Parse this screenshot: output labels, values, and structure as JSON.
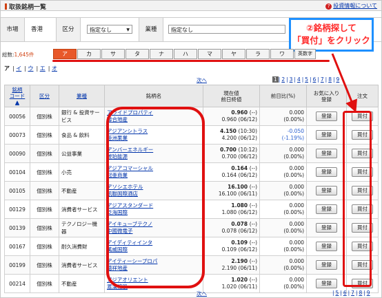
{
  "header": {
    "title": "取扱銘柄一覧",
    "help_link": "投資情報について",
    "help_icon": "help-icon"
  },
  "filter": {
    "market_label": "市場",
    "market_value": "香港",
    "kubun_label": "区分",
    "kubun_value": "指定なし",
    "industry_label": "業種",
    "industry_value": "指定なし"
  },
  "callout": {
    "line1": "②銘柄探して",
    "line2": "「買付」をクリック",
    "border_color": "#1e90ff",
    "text_color": "#ff2a2a"
  },
  "count": {
    "label": "総数:",
    "value": "1,645件"
  },
  "kana_tabs": [
    "ア",
    "カ",
    "サ",
    "タ",
    "ナ",
    "ハ",
    "マ",
    "ヤ",
    "ラ",
    "ワ",
    "英数字"
  ],
  "active_kana": "ア",
  "sub_tabs": {
    "current": "ア",
    "links": [
      "イ",
      "ウ",
      "エ",
      "オ"
    ]
  },
  "pager_top": {
    "next": "次へ",
    "current": "1",
    "pages": [
      "2",
      "3",
      "4",
      "5",
      "6",
      "7",
      "8",
      "9"
    ]
  },
  "pager_bottom": {
    "next": "次へ",
    "pages": [
      "5",
      "6",
      "7",
      "8",
      "9"
    ]
  },
  "table": {
    "headers": {
      "code": "銘柄\nコード\n▲",
      "kubun": "区分",
      "industry": "業種",
      "name": "銘柄名",
      "price": "現在値\n前日終値",
      "change": "前日比(%)",
      "fav": "お気に入り\n登録",
      "order": "注文"
    },
    "fav_label": "登録",
    "buy_label": "買付",
    "rows": [
      {
        "code": "00056",
        "kubun": "個別株",
        "industry": "銀行 & 投資サービス",
        "name1": "アライドプロパティ",
        "name2": "聯合地産",
        "price": "0.960",
        "ptime": "(--)",
        "prev": "0.960",
        "pdate": "(06/12)",
        "chg1": "0.000",
        "chg2": "(0.00%)"
      },
      {
        "code": "00073",
        "kubun": "個別株",
        "industry": "食品 & 飲料",
        "name1": "アジアンシトラス",
        "name2": "亜洲果業",
        "price": "4.150",
        "ptime": "(10:30)",
        "prev": "4.200",
        "pdate": "(06/12)",
        "chg1": "-0.050",
        "chg2": "(-1.19%)"
      },
      {
        "code": "00090",
        "kubun": "個別株",
        "industry": "公益事業",
        "name1": "アンバーエネルギー",
        "name2": "琥珀能源",
        "price": "0.700",
        "ptime": "(10:12)",
        "prev": "0.700",
        "pdate": "(06/12)",
        "chg1": "0.000",
        "chg2": "(0.00%)"
      },
      {
        "code": "00104",
        "kubun": "個別株",
        "industry": "小売",
        "name1": "アジアコマーシャル",
        "name2": "冠亜商業",
        "price": "0.164",
        "ptime": "(--)",
        "prev": "0.164",
        "pdate": "(06/12)",
        "chg1": "0.000",
        "chg2": "(0.00%)"
      },
      {
        "code": "00105",
        "kubun": "個別株",
        "industry": "不動産",
        "name1": "アソシエホテル",
        "name2": "凱聯国際酒店",
        "price": "16.100",
        "ptime": "(--)",
        "prev": "16.100",
        "pdate": "(06/11)",
        "chg1": "0.000",
        "chg2": "(0.00%)"
      },
      {
        "code": "00129",
        "kubun": "個別株",
        "industry": "消費者サービス",
        "name1": "アジアスタンダード",
        "name2": "泛海国際",
        "price": "1.080",
        "ptime": "(--)",
        "prev": "1.080",
        "pdate": "(06/12)",
        "chg1": "0.000",
        "chg2": "(0.00%)"
      },
      {
        "code": "00139",
        "kubun": "個別株",
        "industry": "テクノロジー機器",
        "name1": "アイキューブテクノ",
        "name2": "中國微電子",
        "price": "0.078",
        "ptime": "(--)",
        "prev": "0.078",
        "pdate": "(06/12)",
        "chg1": "0.000",
        "chg2": "(0.00%)"
      },
      {
        "code": "00167",
        "kubun": "個別株",
        "industry": "耐久消費財",
        "name1": "アイディティインタ",
        "name2": "萬威国際",
        "price": "0.109",
        "ptime": "(--)",
        "prev": "0.109",
        "pdate": "(06/12)",
        "chg1": "0.000",
        "chg2": "(0.00%)"
      },
      {
        "code": "00199",
        "kubun": "個別株",
        "industry": "消費者サービス",
        "name1": "アイティーシープロパ",
        "name2": "德祥地産",
        "price": "2.190",
        "ptime": "(--)",
        "prev": "2.190",
        "pdate": "(06/11)",
        "chg1": "0.000",
        "chg2": "(0.00%)"
      },
      {
        "code": "00214",
        "kubun": "個別株",
        "industry": "不動産",
        "name1": "アジアオリエント",
        "name2": "滙漢控股",
        "price": "1.020",
        "ptime": "(--)",
        "prev": "1.020",
        "pdate": "(06/11)",
        "chg1": "0.000",
        "chg2": "(0.00%)"
      }
    ]
  }
}
